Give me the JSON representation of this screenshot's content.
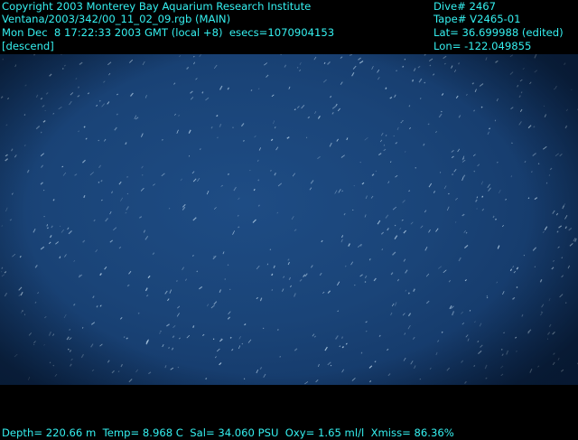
{
  "overlay": {
    "copyright": "Copyright 2003 Monterey Bay Aquarium Research Institute",
    "file": "Ventana/2003/342/00_11_02_09.rgb (MAIN)",
    "datetime": "Mon Dec  8 17:22:33 2003 GMT (local +8)  esecs=1070904153",
    "mode": "[descend]",
    "dive": "Dive# 2467",
    "tape": "Tape# V2465-01",
    "lat": "Lat= 36.699988 (edited)",
    "lon": "Lon= -122.049855",
    "telemetry": "Depth= 220.66 m  Temp= 8.968 C  Sal= 34.060 PSU  Oxy= 1.65 ml/l  Xmiss= 86.36%"
  },
  "colors": {
    "overlay_text": "#35f0f0",
    "water": "#1a4478",
    "bars": "#000000"
  }
}
